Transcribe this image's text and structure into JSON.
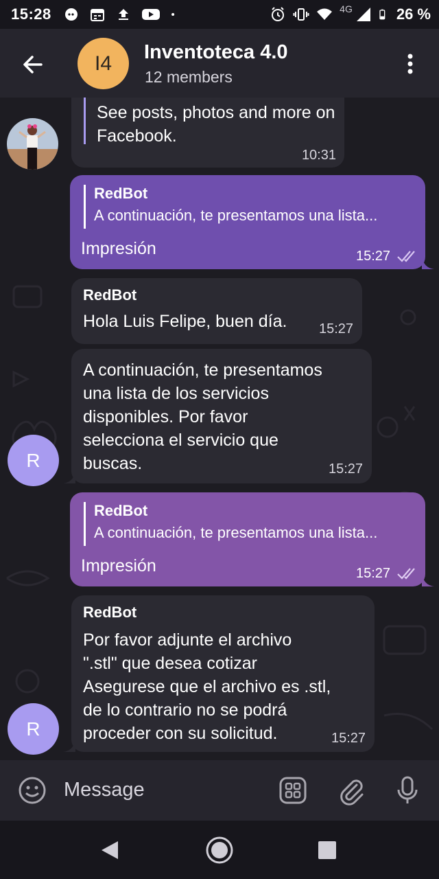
{
  "status_bar": {
    "time": "15:28",
    "battery": "26 %",
    "network": "4G"
  },
  "header": {
    "avatar_initials": "I4",
    "title": "Inventoteca 4.0",
    "subtitle": "12 members"
  },
  "messages": [
    {
      "direction": "in",
      "text": "See posts, photos and more on Facebook.",
      "time": "10:31"
    },
    {
      "direction": "out",
      "reply_name": "RedBot",
      "reply_text": "A continuación, te presentamos una lista...",
      "text": "Impresión",
      "time": "15:27"
    },
    {
      "direction": "in",
      "sender": "RedBot",
      "text": "Hola Luis Felipe, buen día.",
      "time": "15:27"
    },
    {
      "direction": "in",
      "lines": [
        "A continuación, te presentamos",
        "una lista de los servicios",
        "disponibles. Por favor",
        "selecciona el servicio que",
        "buscas."
      ],
      "time": "15:27",
      "avatar": "R"
    },
    {
      "direction": "out",
      "reply_name": "RedBot",
      "reply_text": "A continuación, te presentamos una lista...",
      "text": "Impresión",
      "time": "15:27"
    },
    {
      "direction": "in",
      "sender": "RedBot",
      "lines": [
        "Por favor adjunte el archivo",
        "\".stl\" que desea cotizar",
        "Asegurese que el archivo es .stl,",
        "de lo contrario no se podrá",
        "proceder con su solicitud."
      ],
      "time": "15:27",
      "avatar": "R"
    }
  ],
  "input": {
    "placeholder": "Message"
  },
  "colors": {
    "outgoing_1": "#6f4fae",
    "outgoing_2": "#8355a8",
    "incoming": "#2b2a32",
    "avatar_group": "#f2b45e",
    "avatar_bot": "#a89bf0"
  }
}
